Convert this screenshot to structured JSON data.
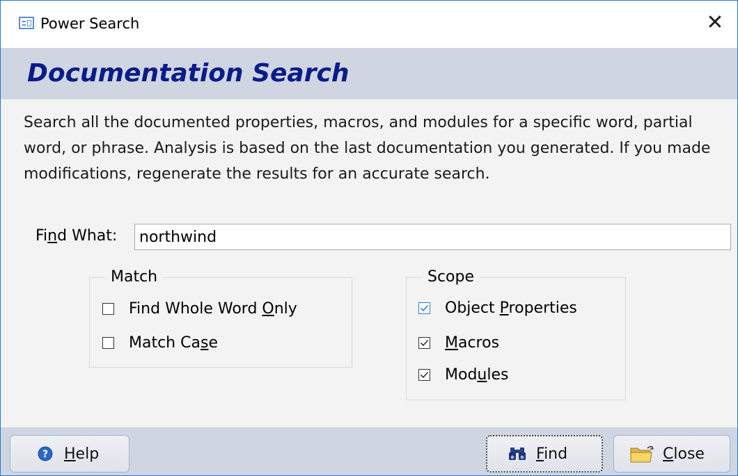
{
  "window": {
    "title": "Power Search",
    "close_glyph": "✕",
    "app_icon": "form-icon",
    "border_color": "#1e78d6"
  },
  "header": {
    "title": "Documentation Search",
    "title_color": "#0a1c8a",
    "band_color": "#cfd5e1"
  },
  "description": "Search all the documented properties, macros, and modules for a specific word, partial word, or phrase. Analysis is based on the last documentation you generated. If you made modifications, regenerate the results for an accurate search.",
  "find": {
    "label_pre": "Fi",
    "label_key": "n",
    "label_post": "d What:",
    "value": "northwind"
  },
  "match": {
    "legend": "Match",
    "options": [
      {
        "pre": "Find Whole Word ",
        "key": "O",
        "post": "nly",
        "checked": false
      },
      {
        "pre": "Match Ca",
        "key": "s",
        "post": "e",
        "checked": false
      }
    ]
  },
  "scope": {
    "legend": "Scope",
    "options": [
      {
        "pre": "Object ",
        "key": "P",
        "post": "roperties",
        "checked": true
      },
      {
        "pre": "",
        "key": "M",
        "post": "acros",
        "checked": true
      },
      {
        "pre": "Mod",
        "key": "u",
        "post": "les",
        "checked": true
      }
    ]
  },
  "buttons": {
    "help": {
      "key": "H",
      "post": "elp",
      "icon": "help-icon"
    },
    "find": {
      "key": "F",
      "post": "ind",
      "icon": "binoculars-icon"
    },
    "close": {
      "key": "C",
      "post": "lose",
      "icon": "folder-icon"
    }
  }
}
